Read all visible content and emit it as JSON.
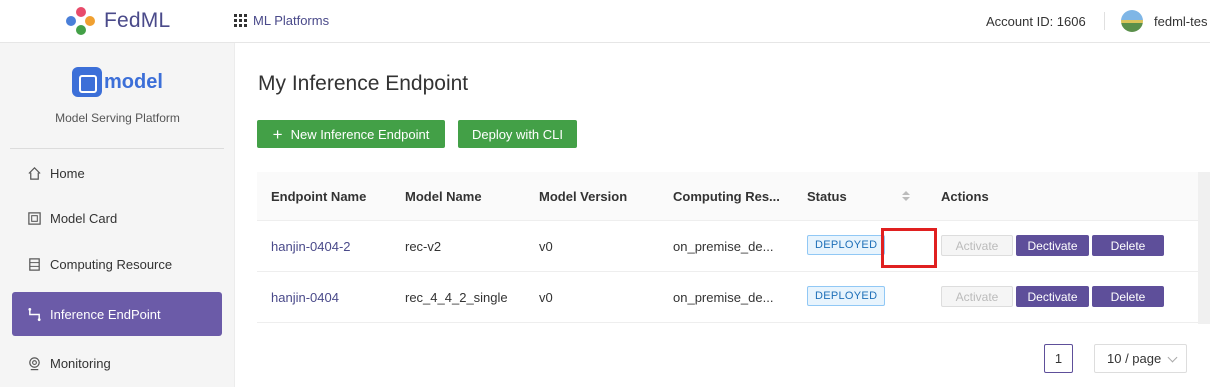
{
  "app": {
    "name": "FedML",
    "platforms_label": "ML Platforms"
  },
  "account": {
    "id_label": "Account ID: 1606",
    "user": "fedml-tes"
  },
  "sidebar": {
    "brand": "model",
    "subtitle": "Model Serving Platform",
    "items": [
      {
        "label": "Home",
        "icon": "home-icon"
      },
      {
        "label": "Model Card",
        "icon": "card-icon"
      },
      {
        "label": "Computing Resource",
        "icon": "server-icon"
      },
      {
        "label": "Inference EndPoint",
        "icon": "route-icon",
        "active": true
      },
      {
        "label": "Monitoring",
        "icon": "monitor-icon"
      }
    ]
  },
  "main": {
    "title": "My Inference Endpoint",
    "new_button": "New Inference Endpoint",
    "new_button_icon": "+",
    "cli_button": "Deploy with CLI",
    "table": {
      "headers": [
        "Endpoint Name",
        "Model Name",
        "Model Version",
        "Computing Res...",
        "Status",
        "Actions"
      ],
      "rows": [
        {
          "endpoint": "hanjin-0404-2",
          "model": "rec-v2",
          "version": "v0",
          "resource": "on_premise_de...",
          "status": "DEPLOYED"
        },
        {
          "endpoint": "hanjin-0404",
          "model": "rec_4_4_2_single",
          "version": "v0",
          "resource": "on_premise_de...",
          "status": "DEPLOYED"
        }
      ],
      "actions": {
        "activate": "Activate",
        "deactivate": "Dectivate",
        "delete": "Delete"
      }
    },
    "pagination": {
      "current": "1",
      "page_size": "10 / page"
    }
  },
  "colors": {
    "brand": "#4a4a8a",
    "green": "#43a047",
    "purple": "#5e4f9a",
    "active_nav": "#6b5ba8",
    "highlight": "#e02020"
  }
}
